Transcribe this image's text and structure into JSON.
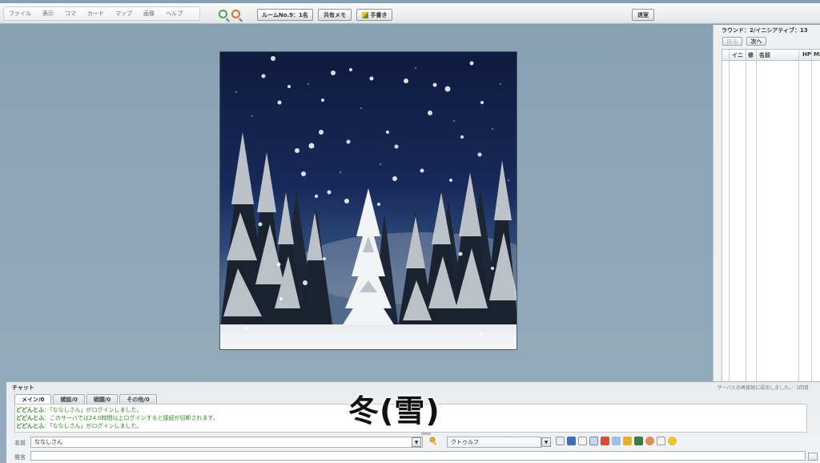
{
  "menu": {
    "items": [
      "ファイル",
      "表示",
      "コマ",
      "カード",
      "マップ",
      "画像",
      "ヘルプ"
    ]
  },
  "toolbar": {
    "room_label": "ルームNo.9：1名",
    "shared_memo_label": "共有メモ",
    "handwriting_label": "手書き",
    "logout_label": "退室"
  },
  "initiative": {
    "round_label": "ラウンド：2/イニシアティブ：13",
    "back_label": "戻る",
    "next_label": "次へ",
    "columns": [
      "イニ",
      "修",
      "名前",
      "HP",
      "MP"
    ]
  },
  "chat": {
    "title": "チャット",
    "reconnect_status": "サーバとの再接続に成功しました。：1回目",
    "tabs": [
      "メイン/0",
      "雑談/0",
      "戦闘/0",
      "その他/0"
    ],
    "log": [
      {
        "speaker": "どどんとふ",
        "text": "：「ななしさん」がログインしました。"
      },
      {
        "speaker": "どどんとふ",
        "text": "：このサーバでは24.0時間以上ログインすると接続が切断されます。"
      },
      {
        "speaker": "どどんとふ",
        "text": "：「ななしさん」がログインしました。"
      }
    ],
    "name_label": "名前",
    "name_value": "ななしさん",
    "system_value": "クトゥルフ",
    "say_label": "発言"
  },
  "overlay": {
    "caption": "冬(雪)"
  },
  "colors": {
    "chat_text": "#2b8a1d",
    "background": "#8ea6b8"
  }
}
